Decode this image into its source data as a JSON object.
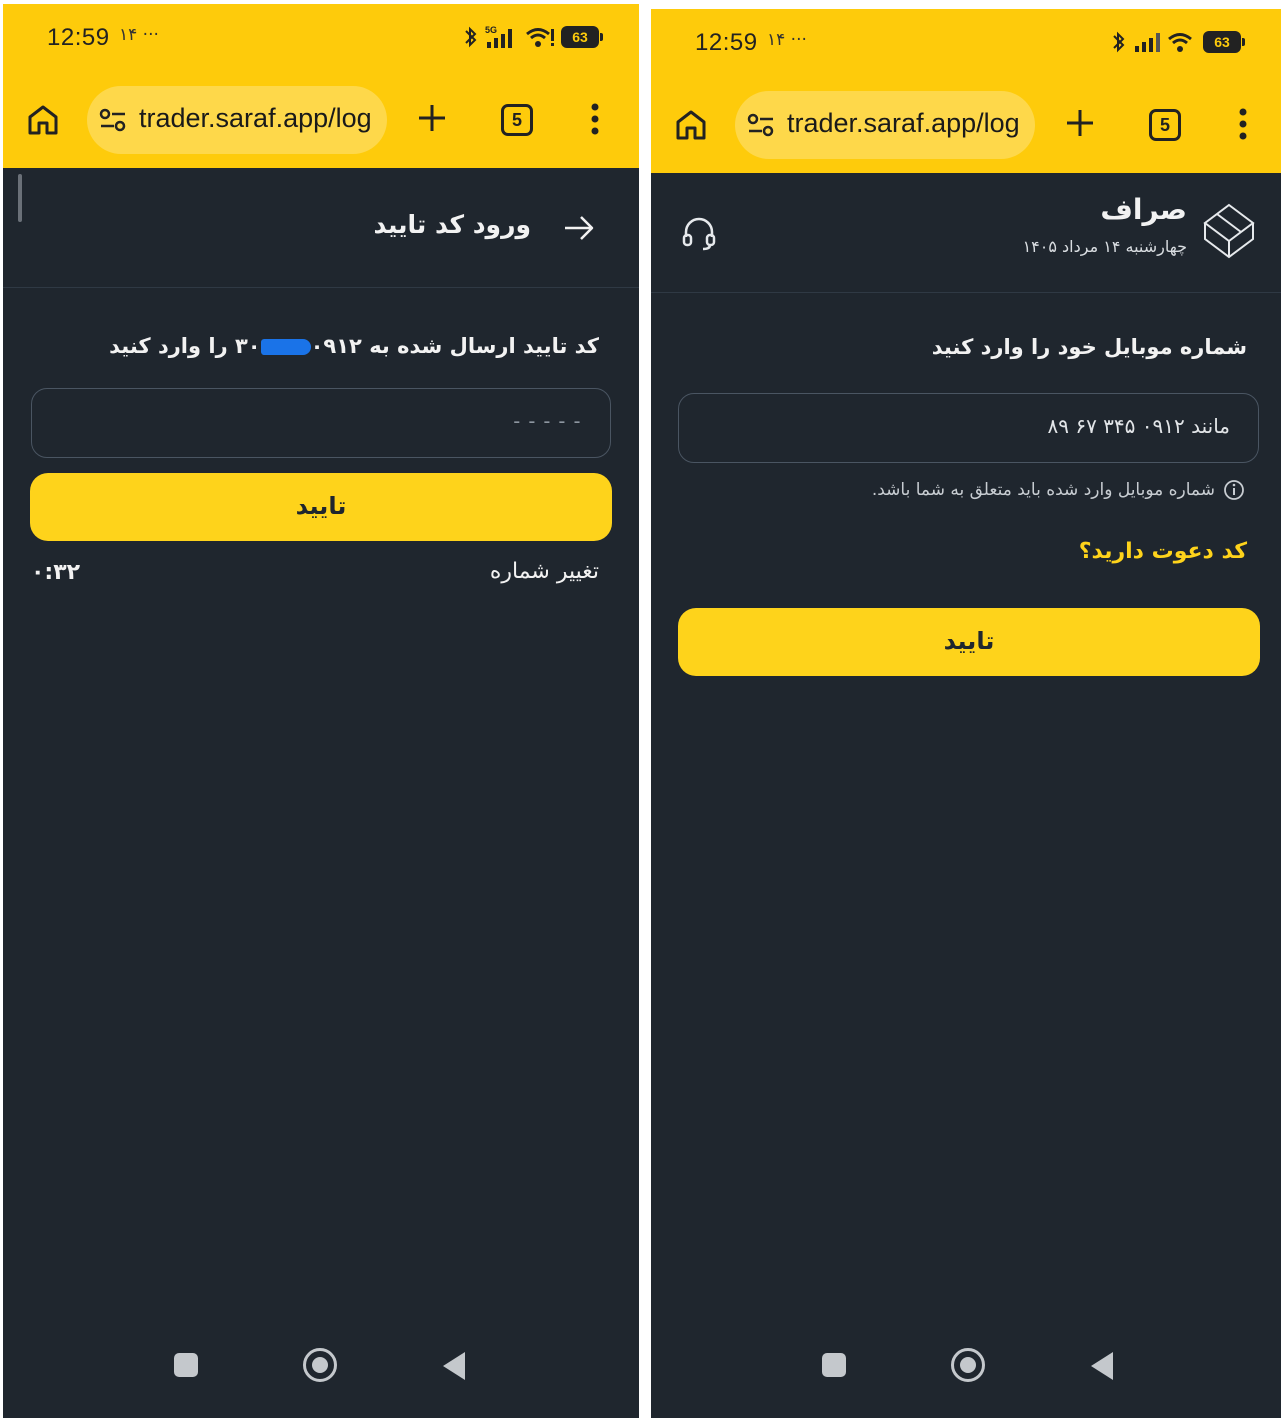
{
  "status_bar": {
    "time": "12:59",
    "extra": "۱۴ ···",
    "battery": "63",
    "network": "5G"
  },
  "browser": {
    "url": "trader.saraf.app/log",
    "tab_count": "5"
  },
  "left_screen": {
    "title": "ورود کد تایید",
    "prompt_prefix": "کد تایید ارسال شده به ۰۹۱۲",
    "prompt_suffix": "۳۰ را وارد کنید",
    "otp_placeholder": "-----",
    "confirm_label": "تایید",
    "change_number_label": "تغییر شماره",
    "timer": "۰:۳۲"
  },
  "right_screen": {
    "brand_name": "صراف",
    "brand_date": "چهارشنبه ۱۴ مرداد ۱۴۰۵",
    "label": "شماره موبایل خود را وارد کنید",
    "phone_placeholder": "مانند ۰۹۱۲ ۳۴۵ ۶۷ ۸۹",
    "hint": "شماره موبایل وارد شده باید متعلق به شما باشد.",
    "invite_link": "کد دعوت دارید؟",
    "confirm_label": "تایید"
  },
  "colors": {
    "accent": "#fed31b",
    "chrome": "#fecb0b",
    "background": "#1f262e"
  }
}
